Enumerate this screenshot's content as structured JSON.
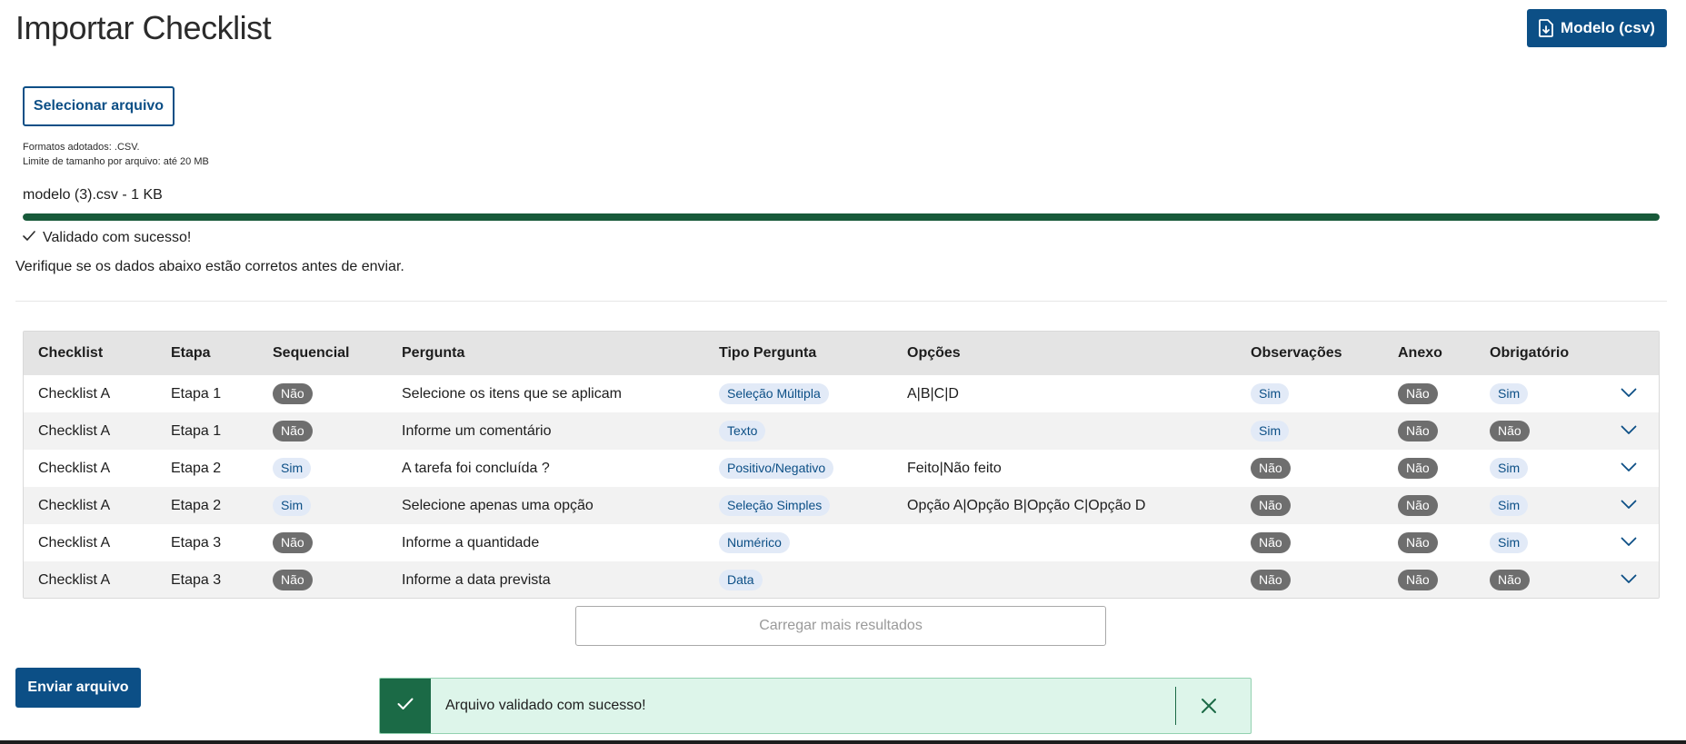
{
  "page": {
    "title": "Importar Checklist"
  },
  "header": {
    "model_button_label": "Modelo (csv)",
    "model_button_icon": "file-download-icon"
  },
  "upload": {
    "select_button_label": "Selecionar arquivo",
    "formats_hint": "Formatos adotados: .CSV.",
    "size_hint": "Limite de tamanho por arquivo: até 20 MB",
    "file_name": "modelo (3).csv - 1 KB",
    "progress_fraction": 1.0,
    "validation_icon": "check-icon",
    "validation_message": "Validado com sucesso!",
    "verify_message": "Verifique se os dados abaixo estão corretos antes de enviar."
  },
  "table": {
    "columns": [
      "Checklist",
      "Etapa",
      "Sequencial",
      "Pergunta",
      "Tipo Pergunta",
      "Opções",
      "Observações",
      "Anexo",
      "Obrigatório"
    ],
    "rows": [
      {
        "checklist": "Checklist A",
        "etapa": "Etapa 1",
        "sequencial": "Não",
        "pergunta": "Selecione os itens que se aplicam",
        "tipo": "Seleção Múltipla",
        "opcoes": "A|B|C|D",
        "observacoes": "Sim",
        "anexo": "Não",
        "obrigatorio": "Sim"
      },
      {
        "checklist": "Checklist A",
        "etapa": "Etapa 1",
        "sequencial": "Não",
        "pergunta": "Informe um comentário",
        "tipo": "Texto",
        "opcoes": "",
        "observacoes": "Sim",
        "anexo": "Não",
        "obrigatorio": "Não"
      },
      {
        "checklist": "Checklist A",
        "etapa": "Etapa 2",
        "sequencial": "Sim",
        "pergunta": "A tarefa foi concluída ?",
        "tipo": "Positivo/Negativo",
        "opcoes": "Feito|Não feito",
        "observacoes": "Não",
        "anexo": "Não",
        "obrigatorio": "Sim"
      },
      {
        "checklist": "Checklist A",
        "etapa": "Etapa 2",
        "sequencial": "Sim",
        "pergunta": "Selecione apenas uma opção",
        "tipo": "Seleção Simples",
        "opcoes": "Opção A|Opção B|Opção C|Opção D",
        "observacoes": "Não",
        "anexo": "Não",
        "obrigatorio": "Sim"
      },
      {
        "checklist": "Checklist A",
        "etapa": "Etapa 3",
        "sequencial": "Não",
        "pergunta": "Informe a quantidade",
        "tipo": "Numérico",
        "opcoes": "",
        "observacoes": "Não",
        "anexo": "Não",
        "obrigatorio": "Sim"
      },
      {
        "checklist": "Checklist A",
        "etapa": "Etapa 3",
        "sequencial": "Não",
        "pergunta": "Informe a data prevista",
        "tipo": "Data",
        "opcoes": "",
        "observacoes": "Não",
        "anexo": "Não",
        "obrigatorio": "Não"
      }
    ],
    "row_expand_icon": "chevron-down-icon"
  },
  "actions": {
    "load_more_label": "Carregar mais resultados",
    "send_label": "Enviar arquivo"
  },
  "toast": {
    "icon": "check-icon",
    "message": "Arquivo validado com sucesso!",
    "close_icon": "close-icon"
  },
  "colors": {
    "primary": "#0c4f86",
    "success_dark": "#1b6a46",
    "success_bg": "#ddf5ea",
    "pill_no": "#6e6e6e",
    "pill_yes_bg": "#e2eaf7"
  }
}
